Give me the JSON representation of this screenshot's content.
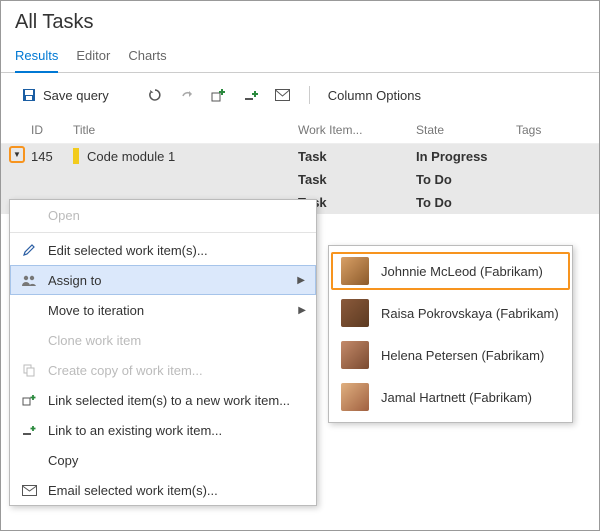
{
  "title": "All Tasks",
  "tabs": [
    {
      "label": "Results",
      "active": true
    },
    {
      "label": "Editor",
      "active": false
    },
    {
      "label": "Charts",
      "active": false
    }
  ],
  "toolbar": {
    "save_query": "Save query",
    "column_options": "Column Options"
  },
  "columns": {
    "id": "ID",
    "title": "Title",
    "wit": "Work Item...",
    "state": "State",
    "tags": "Tags"
  },
  "rows": [
    {
      "id": "145",
      "title": "Code module 1",
      "wit": "Task",
      "state": "In Progress",
      "selected": true
    },
    {
      "id": "",
      "title": "",
      "wit": "Task",
      "state": "To Do",
      "selected": true
    },
    {
      "id": "",
      "title": "",
      "wit": "Task",
      "state": "To Do",
      "selected": true
    }
  ],
  "context_menu": [
    {
      "label": "Open",
      "icon": "",
      "disabled": true
    },
    {
      "sep": true
    },
    {
      "label": "Edit selected work item(s)...",
      "icon": "edit"
    },
    {
      "label": "Assign to",
      "icon": "people",
      "submenu": true,
      "highlight": true
    },
    {
      "label": "Move to iteration",
      "icon": "",
      "submenu": true
    },
    {
      "label": "Clone work item",
      "icon": "",
      "disabled": true
    },
    {
      "label": "Create copy of work item...",
      "icon": "copy",
      "disabled": true
    },
    {
      "label": "Link selected item(s) to a new work item...",
      "icon": "link-new"
    },
    {
      "label": "Link to an existing work item...",
      "icon": "link-existing"
    },
    {
      "label": "Copy",
      "icon": ""
    },
    {
      "label": "Email selected work item(s)...",
      "icon": "mail"
    }
  ],
  "assignees": [
    {
      "name": "Johnnie McLeod  (Fabrikam)",
      "highlight": true
    },
    {
      "name": "Raisa Pokrovskaya (Fabrikam)"
    },
    {
      "name": "Helena Petersen (Fabrikam)"
    },
    {
      "name": "Jamal Hartnett (Fabrikam)"
    }
  ]
}
